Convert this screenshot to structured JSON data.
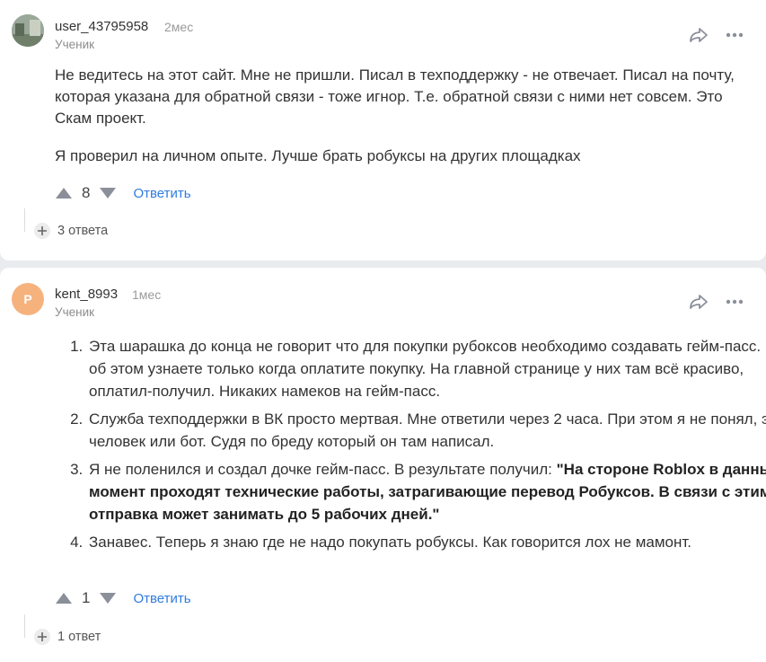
{
  "comments": [
    {
      "username": "user_43795958",
      "time": "2мес",
      "role": "Ученик",
      "paragraphs": [
        "Не ведитесь на этот сайт. Мне не пришли. Писал в техподдержку - не отвечает. Писал на почту, которая указана для обратной связи - тоже игнор. Т.е. обратной связи с ними нет совсем. Это Скам проект.",
        "Я проверил на личном опыте. Лучше брать робуксы на других площадках"
      ],
      "votes": "8",
      "reply_label": "Ответить",
      "answers_label": "3 ответа"
    },
    {
      "username": "kent_8993",
      "avatar_letter": "P",
      "time": "1мес",
      "role": "Ученик",
      "points": [
        {
          "text": "Эта шарашка до конца не говорит что для покупки рубоксов необходимо создавать гейм-пасс. Вы об этом узнаете только когда оплатите покупку. На главной странице у них там всё красиво, оплатил-получил. Никаких намеков на гейм-пасс."
        },
        {
          "text": "Служба техподдержки в ВК просто мертвая. Мне ответили через 2 часа. При этом я не понял, это человек или бот. Судя по бреду который он там написал."
        },
        {
          "text": "Я не поленился и создал дочке гейм-пасс. В результате получил: ",
          "bold": "\"На стороне Roblox в данный момент проходят технические работы, затрагивающие перевод Робуксов. В связи с этим отправка может занимать до 5 рабочих дней.\""
        },
        {
          "text": "Занавес. Теперь я знаю где не надо покупать робуксы. Как говорится лох не мамонт."
        }
      ],
      "votes": "1",
      "reply_label": "Ответить",
      "answers_label": "1 ответ"
    }
  ],
  "colors": {
    "link": "#2f7be0",
    "avatar_orange": "#f6b27d",
    "icon_gray": "#8a8f99"
  },
  "icons": [
    "share-icon",
    "more-icon",
    "upvote-icon",
    "downvote-icon",
    "plus-icon"
  ]
}
